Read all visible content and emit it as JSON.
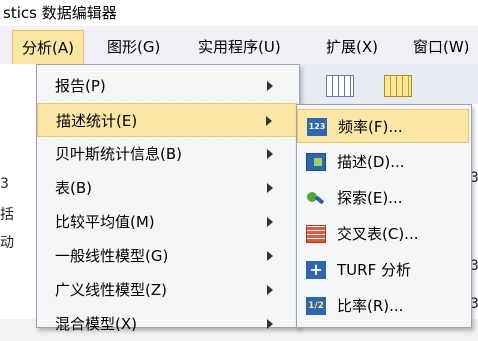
{
  "window": {
    "title": "stics 数据编辑器"
  },
  "menubar": {
    "items": [
      {
        "label": "分析(A)"
      },
      {
        "label": "图形(G)"
      },
      {
        "label": "实用程序(U)"
      },
      {
        "label": "扩展(X)"
      },
      {
        "label": "窗口(W)"
      }
    ]
  },
  "background": {
    "left_fragments": [
      "3",
      "括",
      "动"
    ],
    "right_fragments": [
      "3",
      "3",
      "3"
    ]
  },
  "analyze_menu": {
    "items": [
      {
        "label": "报告(P)"
      },
      {
        "label": "描述统计(E)"
      },
      {
        "label": "贝叶斯统计信息(B)"
      },
      {
        "label": "表(B)"
      },
      {
        "label": "比较平均值(M)"
      },
      {
        "label": "一般线性模型(G)"
      },
      {
        "label": "广义线性模型(Z)"
      },
      {
        "label": "混合模型(X)"
      }
    ]
  },
  "descriptive_menu": {
    "items": [
      {
        "label": "频率(F)...",
        "icon": "frequencies-icon"
      },
      {
        "label": "描述(D)...",
        "icon": "descriptives-icon"
      },
      {
        "label": "探索(E)...",
        "icon": "explore-icon"
      },
      {
        "label": "交叉表(C)...",
        "icon": "crosstabs-icon"
      },
      {
        "label": "TURF 分析",
        "icon": "turf-icon"
      },
      {
        "label": "比率(R)...",
        "icon": "ratio-icon"
      }
    ],
    "icon_texts": {
      "frequencies": "123",
      "turf": "+",
      "ratio": "1/2"
    }
  }
}
